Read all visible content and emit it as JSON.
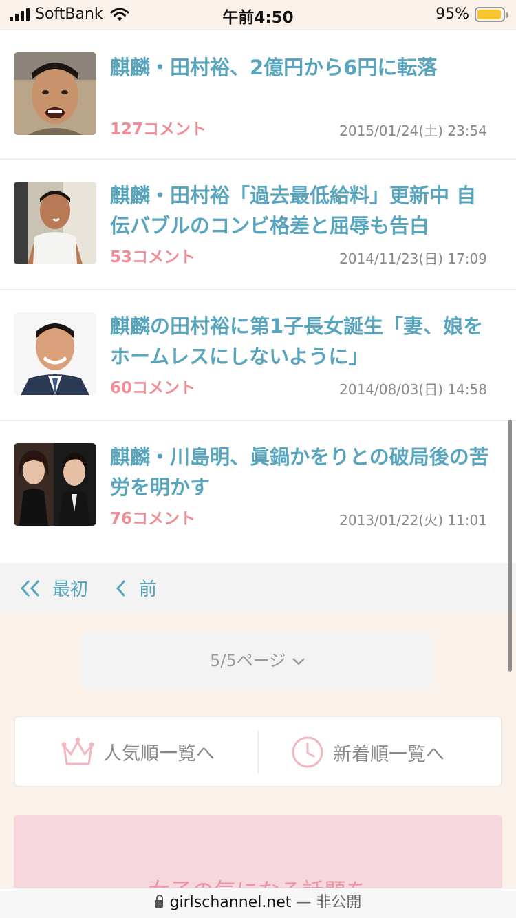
{
  "status_bar": {
    "carrier": "SoftBank",
    "time": "午前4:50",
    "battery": "95%",
    "battery_level": 0.95
  },
  "articles": [
    {
      "title": "麒麟・田村裕、2億円から6円に転落",
      "comments": "127コメント",
      "date": "2015/01/24(土) 23:54"
    },
    {
      "title": "麒麟・田村裕「過去最低給料」更新中 自伝バブルのコンビ格差と屈辱も告白",
      "comments": "53コメント",
      "date": "2014/11/23(日) 17:09"
    },
    {
      "title": "麒麟の田村裕に第1子長女誕生「妻、娘をホームレスにしないように」",
      "comments": "60コメント",
      "date": "2014/08/03(日) 14:58"
    },
    {
      "title": "麒麟・川島明、眞鍋かをりとの破局後の苦労を明かす",
      "comments": "76コメント",
      "date": "2013/01/22(火) 11:01"
    }
  ],
  "pager": {
    "first_label": "最初",
    "prev_label": "前"
  },
  "page_select": {
    "label": "5/5ページ"
  },
  "sort": {
    "popular_label": "人気順一覧へ",
    "new_label": "新着順一覧へ"
  },
  "promo": {
    "text": "女子の気になる話題を"
  },
  "url_bar": {
    "domain": "girlschannel.net",
    "visibility": "— 非公開"
  },
  "colors": {
    "title": "#58a5bd",
    "comments": "#ef8e96",
    "background": "#faf1ea",
    "promo": "#f5d7dd"
  }
}
